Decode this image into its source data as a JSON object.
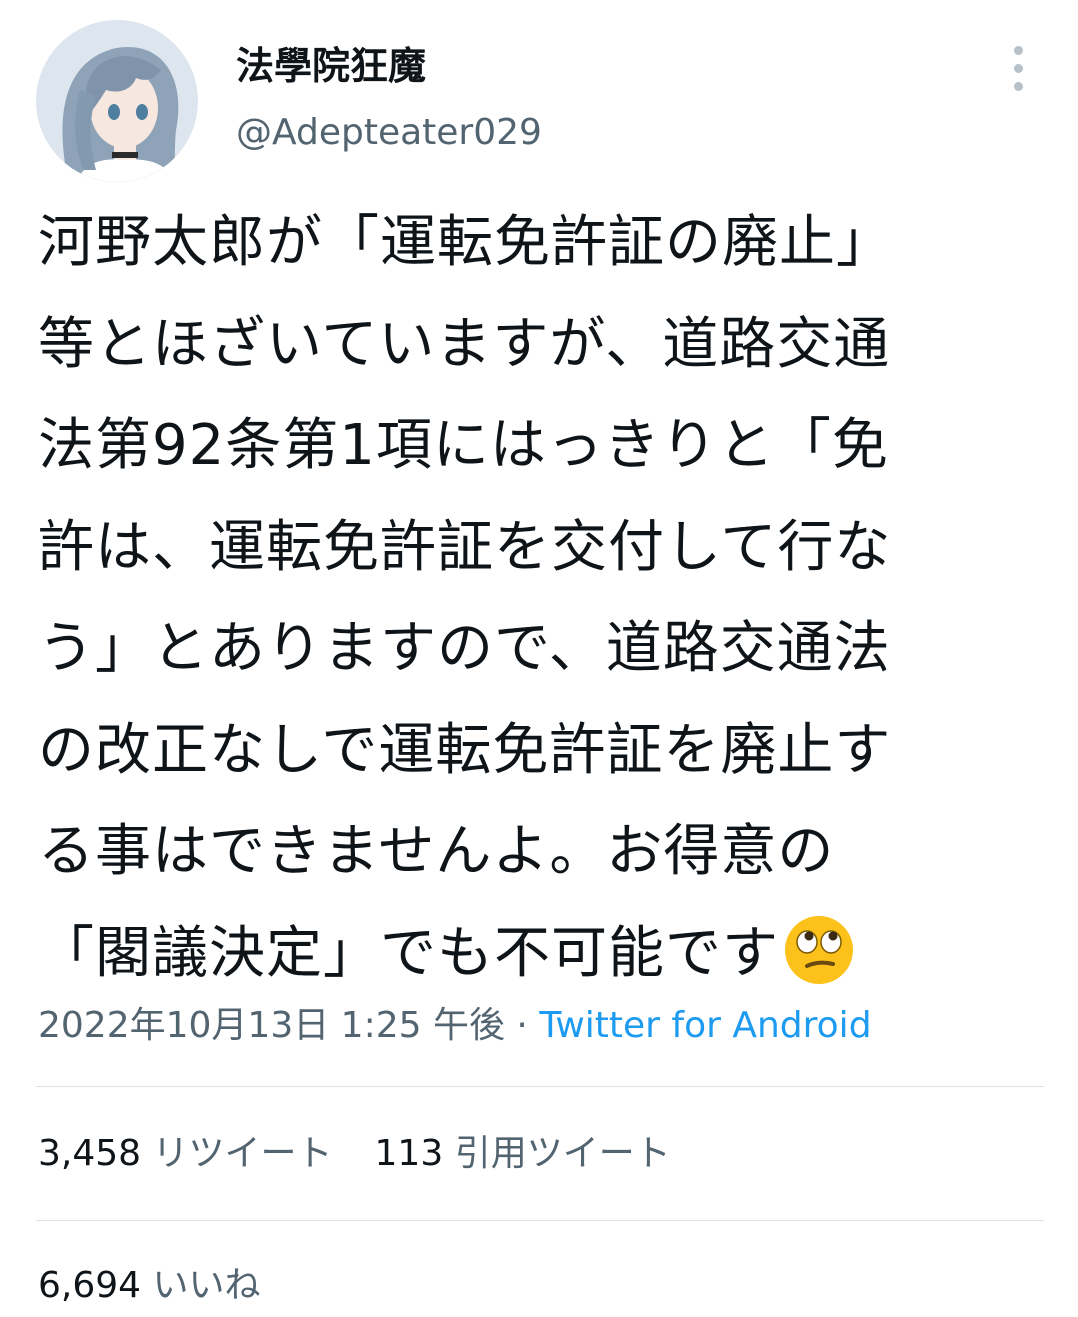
{
  "user": {
    "display_name": "法學院狂魔",
    "handle": "@Adepteater029"
  },
  "tweet": {
    "lines": [
      "河野太郎が「運転免許証の廃止」",
      "等とほざいていますが、道路交通",
      "法第92条第1項にはっきりと「免",
      "許は、運転免許証を交付して行な",
      "う」とありますので、道路交通法",
      "の改正なしで運転免許証を廃止す",
      "る事はできませんよ。お得意の",
      "「閣議決定」でも不可能です"
    ],
    "trailing_emoji": "face-with-rolling-eyes-icon"
  },
  "meta": {
    "timestamp": "2022年10月13日 1:25 午後",
    "separator": " · ",
    "source": "Twitter for Android"
  },
  "stats": {
    "retweets_count": "3,458",
    "retweets_label": "リツイート",
    "quotes_count": "113",
    "quotes_label": "引用ツイート",
    "likes_count": "6,694",
    "likes_label": "いいね"
  },
  "colors": {
    "text_primary": "#0f1419",
    "text_secondary": "#536471",
    "link": "#1d9bf0",
    "divider": "#dfe3e6"
  }
}
